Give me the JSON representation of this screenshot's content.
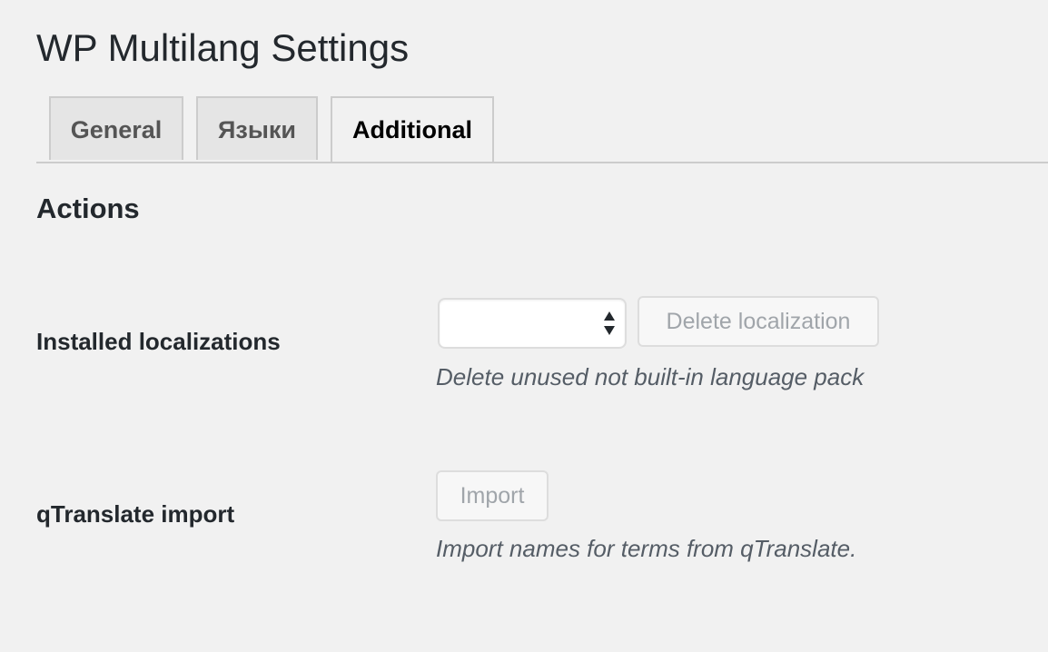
{
  "page": {
    "title": "WP Multilang Settings"
  },
  "tabs": [
    {
      "label": "General",
      "active": false
    },
    {
      "label": "Языки",
      "active": false
    },
    {
      "label": "Additional",
      "active": true
    }
  ],
  "actions": {
    "heading": "Actions",
    "installed_localizations": {
      "label": "Installed localizations",
      "select_value": "",
      "button_label": "Delete localization",
      "description": "Delete unused not built-in language pack"
    },
    "qtranslate_import": {
      "label": "qTranslate import",
      "button_label": "Import",
      "description": "Import names for terms from qTranslate."
    }
  },
  "icons": {
    "select_arrows": "up-down-arrows-icon"
  },
  "colors": {
    "background": "#f1f1f1",
    "text": "#23282d",
    "disabled_button_text": "#a0a5aa",
    "description_text": "#555d66",
    "tab_inactive_bg": "#e5e5e5",
    "border": "#cccccc"
  }
}
